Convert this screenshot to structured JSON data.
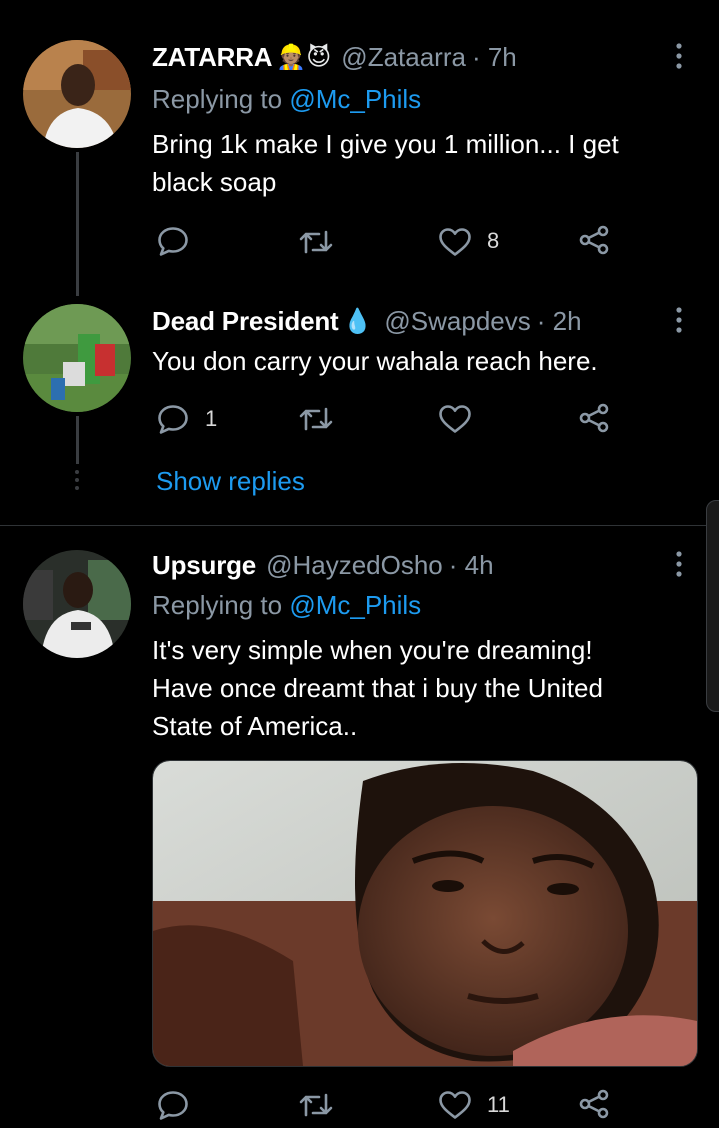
{
  "tweets": [
    {
      "name": "ZATARRA",
      "emoji": "👷🏽😈",
      "handle": "@Zataarra",
      "time": "· 7h",
      "reply_prefix": "Replying to ",
      "reply_mention": "@Mc_Phils",
      "lines": [
        "Bring 1k make I give you 1 million... I get",
        "black soap"
      ],
      "likes": "8"
    },
    {
      "name": "Dead President",
      "emoji": "💧",
      "handle": "@Swapdevs",
      "time": "· 2h",
      "lines": [
        "You don carry your wahala reach here."
      ],
      "replies": "1"
    },
    {
      "name": "Upsurge",
      "handle": "@HayzedOsho",
      "time": "· 4h",
      "reply_prefix": "Replying to ",
      "reply_mention": "@Mc_Phils",
      "lines": [
        "It's very simple when you're dreaming!",
        "Have once dreamt that i buy the United",
        "State of America.."
      ],
      "likes": "11"
    }
  ],
  "show_replies": "Show replies",
  "colors": {
    "accent": "#1d9bf0",
    "muted": "#8b98a5",
    "background": "#000000"
  }
}
